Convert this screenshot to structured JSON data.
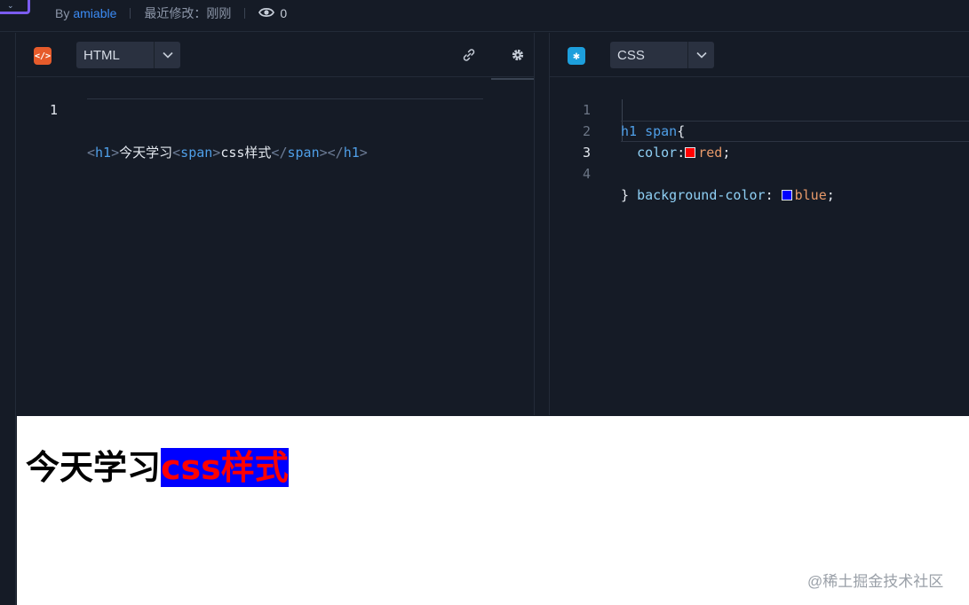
{
  "header": {
    "by_prefix": "By",
    "author": "amiable",
    "last_modified": "最近修改：刚刚",
    "views": "0"
  },
  "html_pane": {
    "language": "HTML",
    "icon": "html-icon",
    "lines": [
      {
        "number": "1"
      }
    ],
    "code": {
      "tag_open_h1_lt": "<",
      "h1": "h1",
      "gt": ">",
      "text1": "今天学习",
      "lt": "<",
      "span": "span",
      "text2": "css样式",
      "close_lt": "</",
      "span_close": "span",
      "h1_close": "h1"
    }
  },
  "css_pane": {
    "language": "CSS",
    "icon": "css-icon",
    "line_numbers": [
      "1",
      "2",
      "3",
      "4"
    ],
    "selector": "h1 span",
    "open_brace": "{",
    "close_brace": "}",
    "prop1": "color",
    "val1": "red",
    "prop2": "background-color",
    "val2": "blue",
    "swatch1_color": "#ff0000",
    "swatch2_color": "#0000ff"
  },
  "preview": {
    "heading_plain": "今天学习",
    "heading_styled": "css样式",
    "watermark": "@稀土掘金技术社区"
  },
  "colors": {
    "accent": "#3b8bf5",
    "html_badge": "#e65b2b",
    "css_badge": "#1d9fdc"
  }
}
